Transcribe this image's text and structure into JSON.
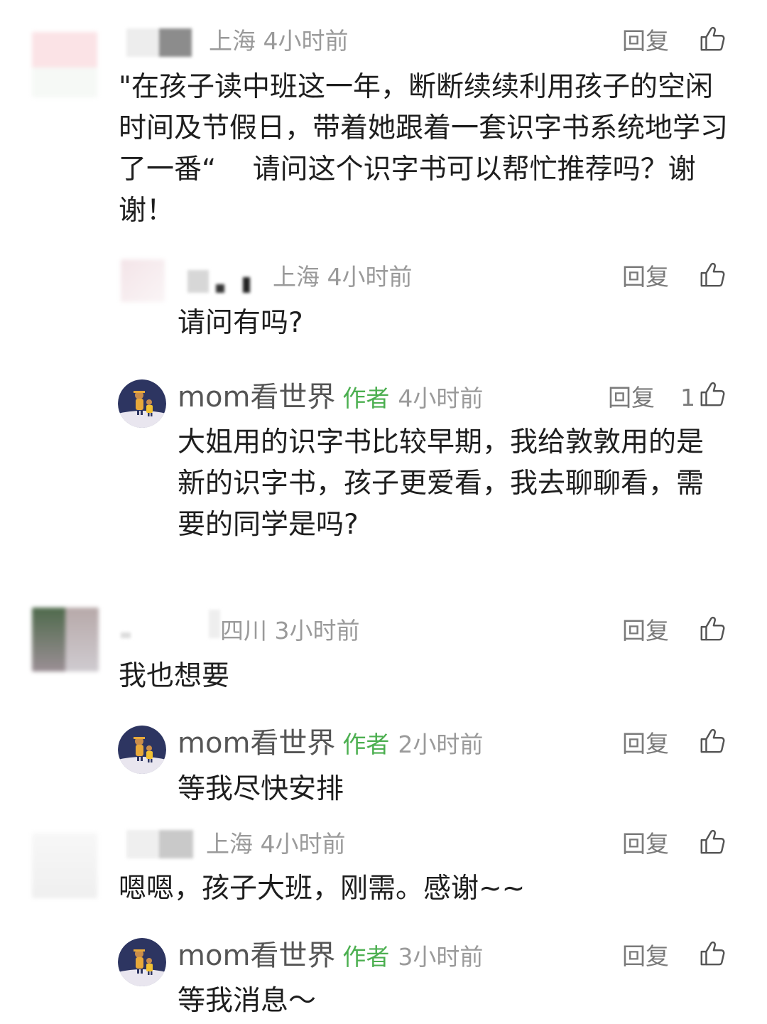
{
  "comments": [
    {
      "location_time": "上海 4小时前",
      "reply_label": "回复",
      "text": "\"在孩子读中班这一年，断断续续利用孩子的空闲时间及节假日，带着她跟着一套识字书系统地学习了一番“ 　请问这个识字书可以帮忙推荐吗？谢谢！"
    },
    {
      "location_time": "上海 4小时前",
      "reply_label": "回复",
      "text": "请问有吗?"
    },
    {
      "name": "mom看世界",
      "author_tag": "作者",
      "time": "4小时前",
      "reply_label": "回复",
      "like_count": "1",
      "text": "大姐用的识字书比较早期，我给敦敦用的是新的识字书，孩子更爱看，我去聊聊看，需要的同学是吗?"
    },
    {
      "location_time": "四川 3小时前",
      "reply_label": "回复",
      "text": "我也想要"
    },
    {
      "name": "mom看世界",
      "author_tag": "作者",
      "time": "2小时前",
      "reply_label": "回复",
      "text": "等我尽快安排"
    },
    {
      "location_time": "上海 4小时前",
      "reply_label": "回复",
      "text": "嗯嗯，孩子大班，刚需。感谢~~"
    },
    {
      "name": "mom看世界",
      "author_tag": "作者",
      "time": "3小时前",
      "reply_label": "回复",
      "text": "等我消息～"
    }
  ],
  "icons": {
    "like": "thumbs-up-icon"
  },
  "colors": {
    "author_tag": "#4caf50",
    "meta": "#9a9a9a"
  }
}
